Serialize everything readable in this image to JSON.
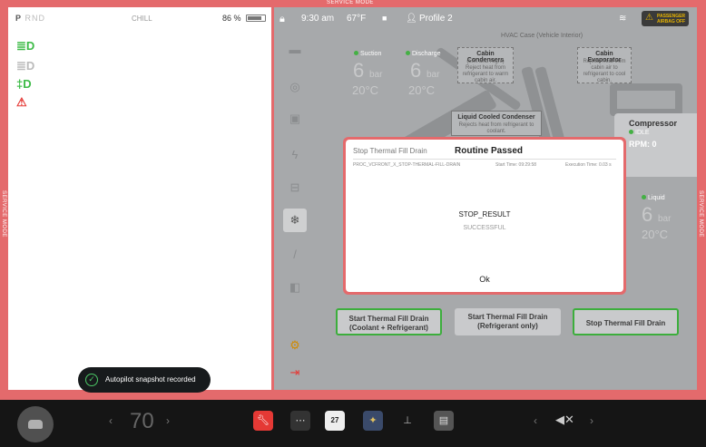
{
  "top_band": {
    "label": "SERVICE MODE"
  },
  "side_labels": {
    "left": "SERVICE MODE",
    "right": "SERVICE MODE"
  },
  "left_panel": {
    "gear": {
      "selected": "P",
      "others": "RND"
    },
    "drive_mode": "CHILL",
    "battery_percent": "86 %",
    "battery_level": 0.86,
    "telltales": [
      {
        "icon": "low-beam-icon",
        "glyph": "≣D",
        "color": "#3dbb47"
      },
      {
        "icon": "auto-beam-icon",
        "glyph": "≣D",
        "color": "#bbbbbb"
      },
      {
        "icon": "fog-light-icon",
        "glyph": "‡D",
        "color": "#3dbb47"
      },
      {
        "icon": "seatbelt-icon",
        "glyph": "⚠",
        "color": "#e53935"
      }
    ],
    "toast": {
      "icon": "check-circle-icon",
      "text": "Autopilot snapshot recorded"
    }
  },
  "top_bar": {
    "time": "9:30 am",
    "outside_temp": "67°F",
    "profile": "Profile 2",
    "airbag_label": "PASSENGER AIRBAG OFF"
  },
  "diagram": {
    "suction": {
      "label": "Suction",
      "value": "6",
      "unit": "bar",
      "temp": "20°C"
    },
    "discharge": {
      "label": "Discharge",
      "value": "6",
      "unit": "bar",
      "temp": "20°C"
    },
    "liquid": {
      "label": "Liquid",
      "value": "6",
      "unit": "bar",
      "temp": "20°C"
    },
    "hvac_case": "HVAC Case (Vehicle Interior)",
    "cabin_condensers": {
      "title": "Cabin Condensers",
      "desc": "(Left and Right) Reject heat from refrigerant to warm cabin air."
    },
    "cabin_evaporator": {
      "title": "Cabin Evaporator",
      "desc": "Rejects heat from cabin air to refrigerant to cool cabin."
    },
    "liquid_cooled_condenser": {
      "title": "Liquid Cooled Condenser",
      "desc": "Rejects heat from refrigerant to coolant."
    },
    "compressor": {
      "title": "Compressor",
      "status": "IDLE",
      "rpm_label": "RPM:",
      "rpm_value": "0"
    }
  },
  "actions": {
    "btn1": "Start Thermal Fill Drain (Coolant + Refrigerant)",
    "btn2": "Start Thermal Fill Drain (Refrigerant only)",
    "btn3": "Stop Thermal Fill Drain"
  },
  "modal": {
    "procedure_label": "Stop Thermal Fill Drain",
    "heading": "Routine Passed",
    "procedure_id": "PROC_VCFRONT_X_STOP-THERMAL-FILL-DRAIN",
    "start_time": "Start Time: 09:29:58",
    "execution_time": "Execution Time: 0.03 s",
    "result_label": "STOP_RESULT",
    "result_value": "SUCCESSFUL",
    "ok_label": "Ok"
  },
  "taskbar": {
    "temperature": "70",
    "calendar_day": "27"
  },
  "colors": {
    "service_red": "#e46a6c",
    "accent_green": "#3cae3c",
    "panel_gray": "#a7a9ab"
  }
}
